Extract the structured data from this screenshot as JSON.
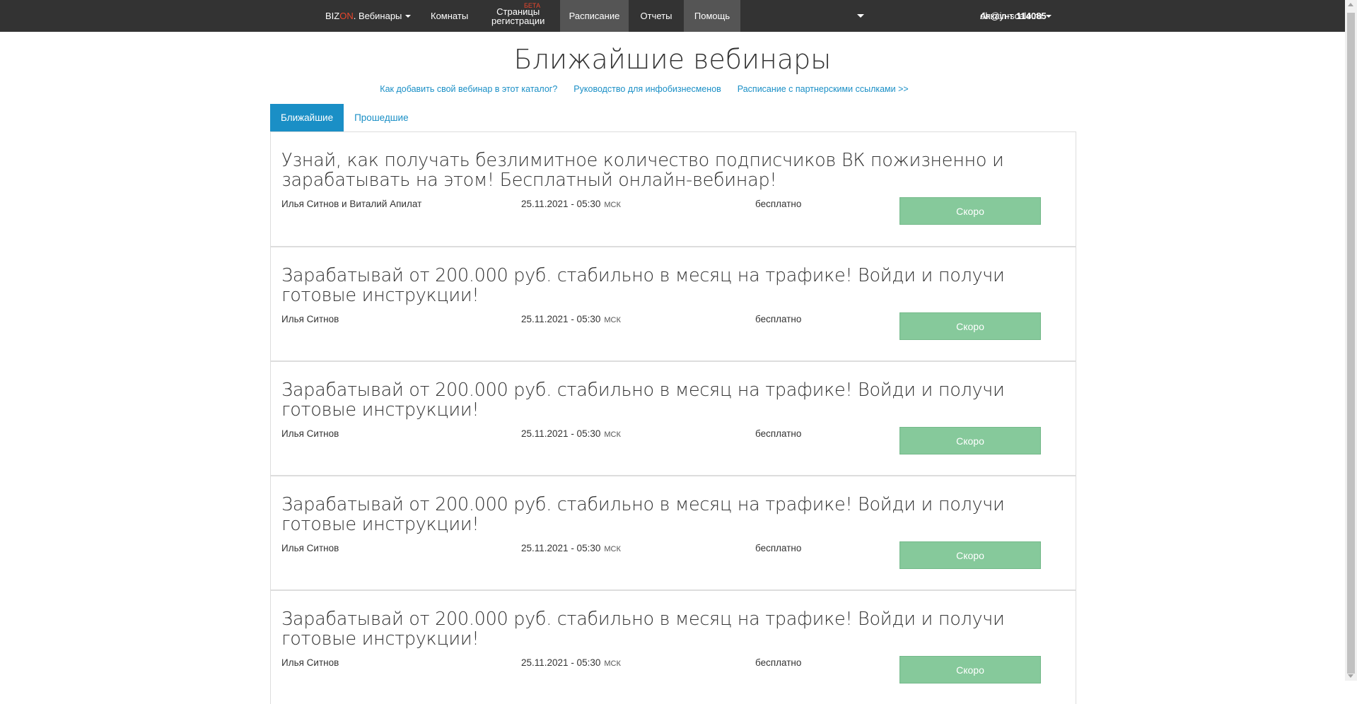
{
  "nav": {
    "brand_biz": "BIZ",
    "brand_on": "ON",
    "brand_rest": ". Вебинары",
    "rooms": "Комнаты",
    "reg_line1": "Страницы",
    "reg_line2": "регистрации",
    "reg_beta": "БЕТА",
    "schedule": "Расписание",
    "reports": "Отчеты",
    "help": "Помощь",
    "account_label": "Аккаунт",
    "account_number": "114085",
    "account_email": "dh@in-scale.ru"
  },
  "page": {
    "title": "Ближайшие вебинары",
    "links": [
      "Как добавить свой вебинар в этот каталог?",
      "Руководство для инфобизнесменов",
      "Расписание с партнерскими ссылками >>"
    ]
  },
  "tabs": {
    "upcoming": "Ближайшие",
    "past": "Прошедшие"
  },
  "webinars": [
    {
      "title": "Узнай, как получать безлимитное количество подписчиков ВК пожизненно и зарабатывать на этом! Бесплатный онлайн-вебинар!",
      "speaker": "Илья Ситнов и Виталий Апилат",
      "date": "25.11.2021 - 05:30",
      "tz": "МСК",
      "price": "бесплатно",
      "button": "Скоро"
    },
    {
      "title": "Зарабатывай от 200.000 руб. стабильно в месяц на трафике! Войди и получи готовые инструкции!",
      "speaker": "Илья Ситнов",
      "date": "25.11.2021 - 05:30",
      "tz": "МСК",
      "price": "бесплатно",
      "button": "Скоро"
    },
    {
      "title": "Зарабатывай от 200.000 руб. стабильно в месяц на трафике! Войди и получи готовые инструкции!",
      "speaker": "Илья Ситнов",
      "date": "25.11.2021 - 05:30",
      "tz": "МСК",
      "price": "бесплатно",
      "button": "Скоро"
    },
    {
      "title": "Зарабатывай от 200.000 руб. стабильно в месяц на трафике! Войди и получи готовые инструкции!",
      "speaker": "Илья Ситнов",
      "date": "25.11.2021 - 05:30",
      "tz": "МСК",
      "price": "бесплатно",
      "button": "Скоро"
    },
    {
      "title": "Зарабатывай от 200.000 руб. стабильно в месяц на трафике! Войди и получи готовые инструкции!",
      "speaker": "Илья Ситнов",
      "date": "25.11.2021 - 05:30",
      "tz": "МСК",
      "price": "бесплатно",
      "button": "Скоро"
    }
  ],
  "colors": {
    "topbar": "#333333",
    "accent": "#1a8fc6",
    "brand_on": "#e8452c",
    "soon_button": "#86c99b"
  }
}
